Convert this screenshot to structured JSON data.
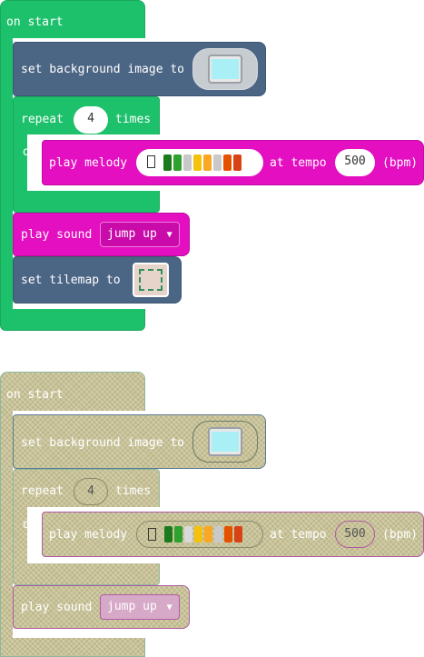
{
  "stacks": [
    {
      "on_start": "on start",
      "set_background": "set background image to",
      "repeat": "repeat",
      "repeat_count": "4",
      "times": "times",
      "do": "do",
      "play_melody": "play melody",
      "at_tempo": "at tempo",
      "tempo": "500",
      "bpm": "(bpm)",
      "play_sound": "play sound",
      "sound_value": "jump up",
      "set_tilemap": "set tilemap to"
    },
    {
      "on_start": "on start",
      "set_background": "set background image to",
      "repeat": "repeat",
      "repeat_count": "4",
      "times": "times",
      "do": "do",
      "play_melody": "play melody",
      "at_tempo": "at tempo",
      "tempo": "500",
      "bpm": "(bpm)",
      "play_sound": "play sound",
      "sound_value": "jump up"
    }
  ],
  "melody_colors": [
    "#1b7a1b",
    "#2ea12e",
    "#8ed08e",
    "#d9d9d9",
    "#f4c20d",
    "#f9a825",
    "#c9c9c9",
    "#e65100",
    "#d84315"
  ],
  "colors": {
    "events_green": "#1ec16b",
    "scene_blue": "#4b6584",
    "music_magenta": "#e30fc0",
    "disabled_olive": "#c8c296"
  },
  "icons": {
    "dropdown": "triangle-down",
    "image_field": "image-thumbnail",
    "tilemap_field": "tilemap-thumbnail"
  }
}
